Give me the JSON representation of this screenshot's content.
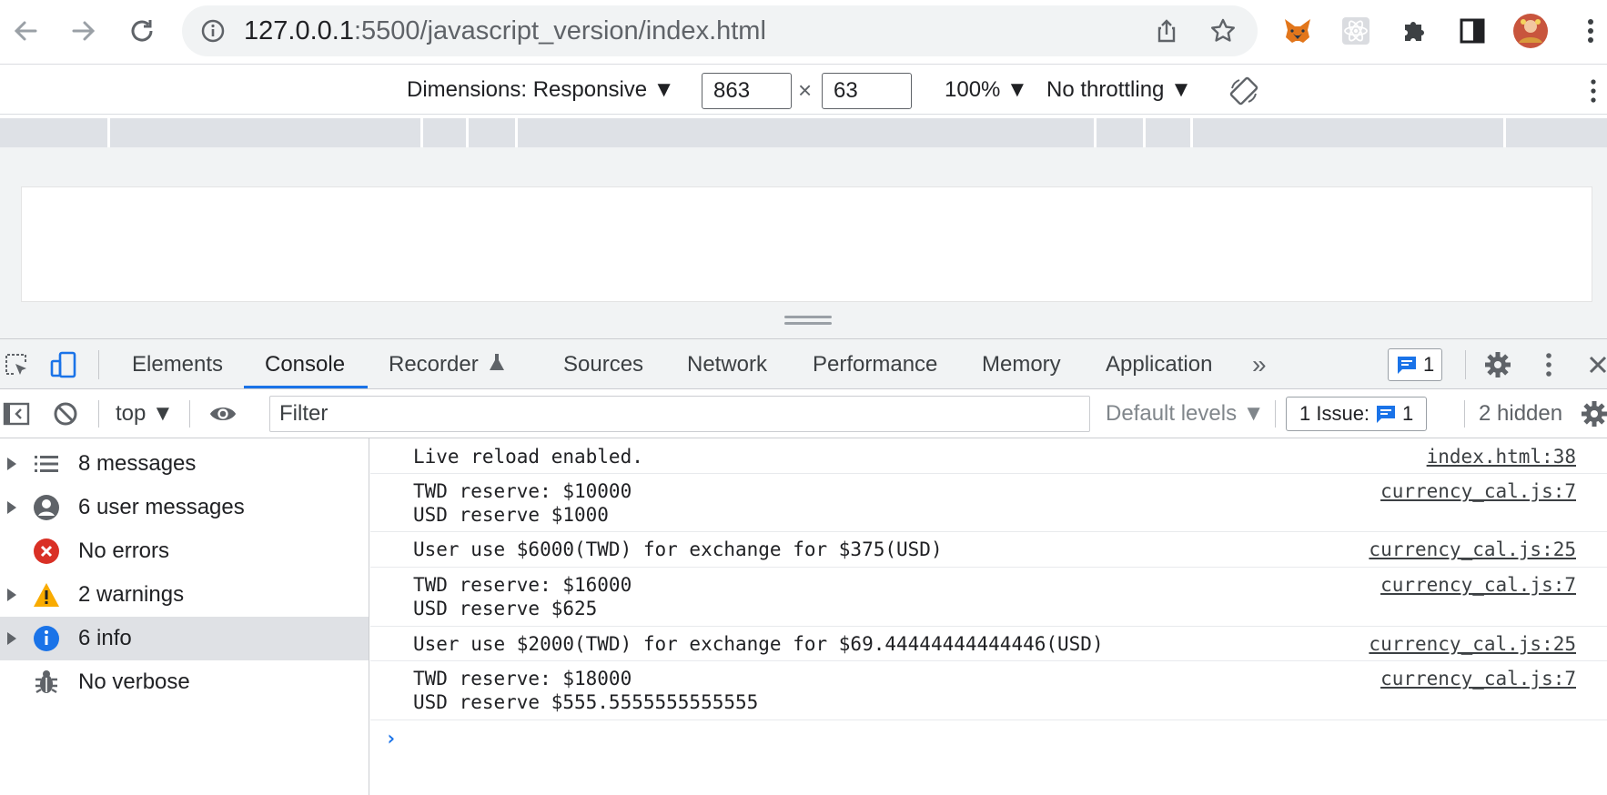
{
  "browser": {
    "url_host": "127.0.0.1",
    "url_path": ":5500/javascript_version/index.html"
  },
  "device_toolbar": {
    "dimensions_label": "Dimensions: Responsive ▼",
    "width_value": "863",
    "times": "×",
    "height_value": "63",
    "zoom_label": "100% ▼",
    "throttling_label": "No throttling ▼"
  },
  "devtools": {
    "tabs": [
      {
        "label": "Elements"
      },
      {
        "label": "Console"
      },
      {
        "label": "Recorder"
      },
      {
        "label": "Sources"
      },
      {
        "label": "Network"
      },
      {
        "label": "Performance"
      },
      {
        "label": "Memory"
      },
      {
        "label": "Application"
      }
    ],
    "more_tabs": "»",
    "message_badge_count": "1",
    "accent_color": "#1a73e8"
  },
  "console_toolbar": {
    "context": "top ▼",
    "filter_placeholder": "Filter",
    "levels": "Default levels ▼",
    "issues_label": "1 Issue:",
    "issues_count": "1",
    "hidden_label": "2 hidden"
  },
  "sidebar": {
    "items": [
      {
        "label": "8 messages",
        "icon": "list-icon"
      },
      {
        "label": "6 user messages",
        "icon": "user-icon"
      },
      {
        "label": "No errors",
        "icon": "error-icon"
      },
      {
        "label": "2 warnings",
        "icon": "warning-icon"
      },
      {
        "label": "6 info",
        "icon": "info-icon"
      },
      {
        "label": "No verbose",
        "icon": "bug-icon"
      }
    ]
  },
  "console_log": [
    {
      "message": "Live reload enabled.",
      "source": "index.html:38"
    },
    {
      "message": "TWD reserve: $10000\nUSD reserve $1000",
      "source": "currency_cal.js:7"
    },
    {
      "message": "User use $6000(TWD) for exchange for $375(USD)",
      "source": "currency_cal.js:25"
    },
    {
      "message": "TWD reserve: $16000\nUSD reserve $625",
      "source": "currency_cal.js:7"
    },
    {
      "message": "User use $2000(TWD) for exchange for $69.44444444444446(USD)",
      "source": "currency_cal.js:25"
    },
    {
      "message": "TWD reserve: $18000\nUSD reserve $555.5555555555555",
      "source": "currency_cal.js:7"
    }
  ],
  "prompt_symbol": "›"
}
